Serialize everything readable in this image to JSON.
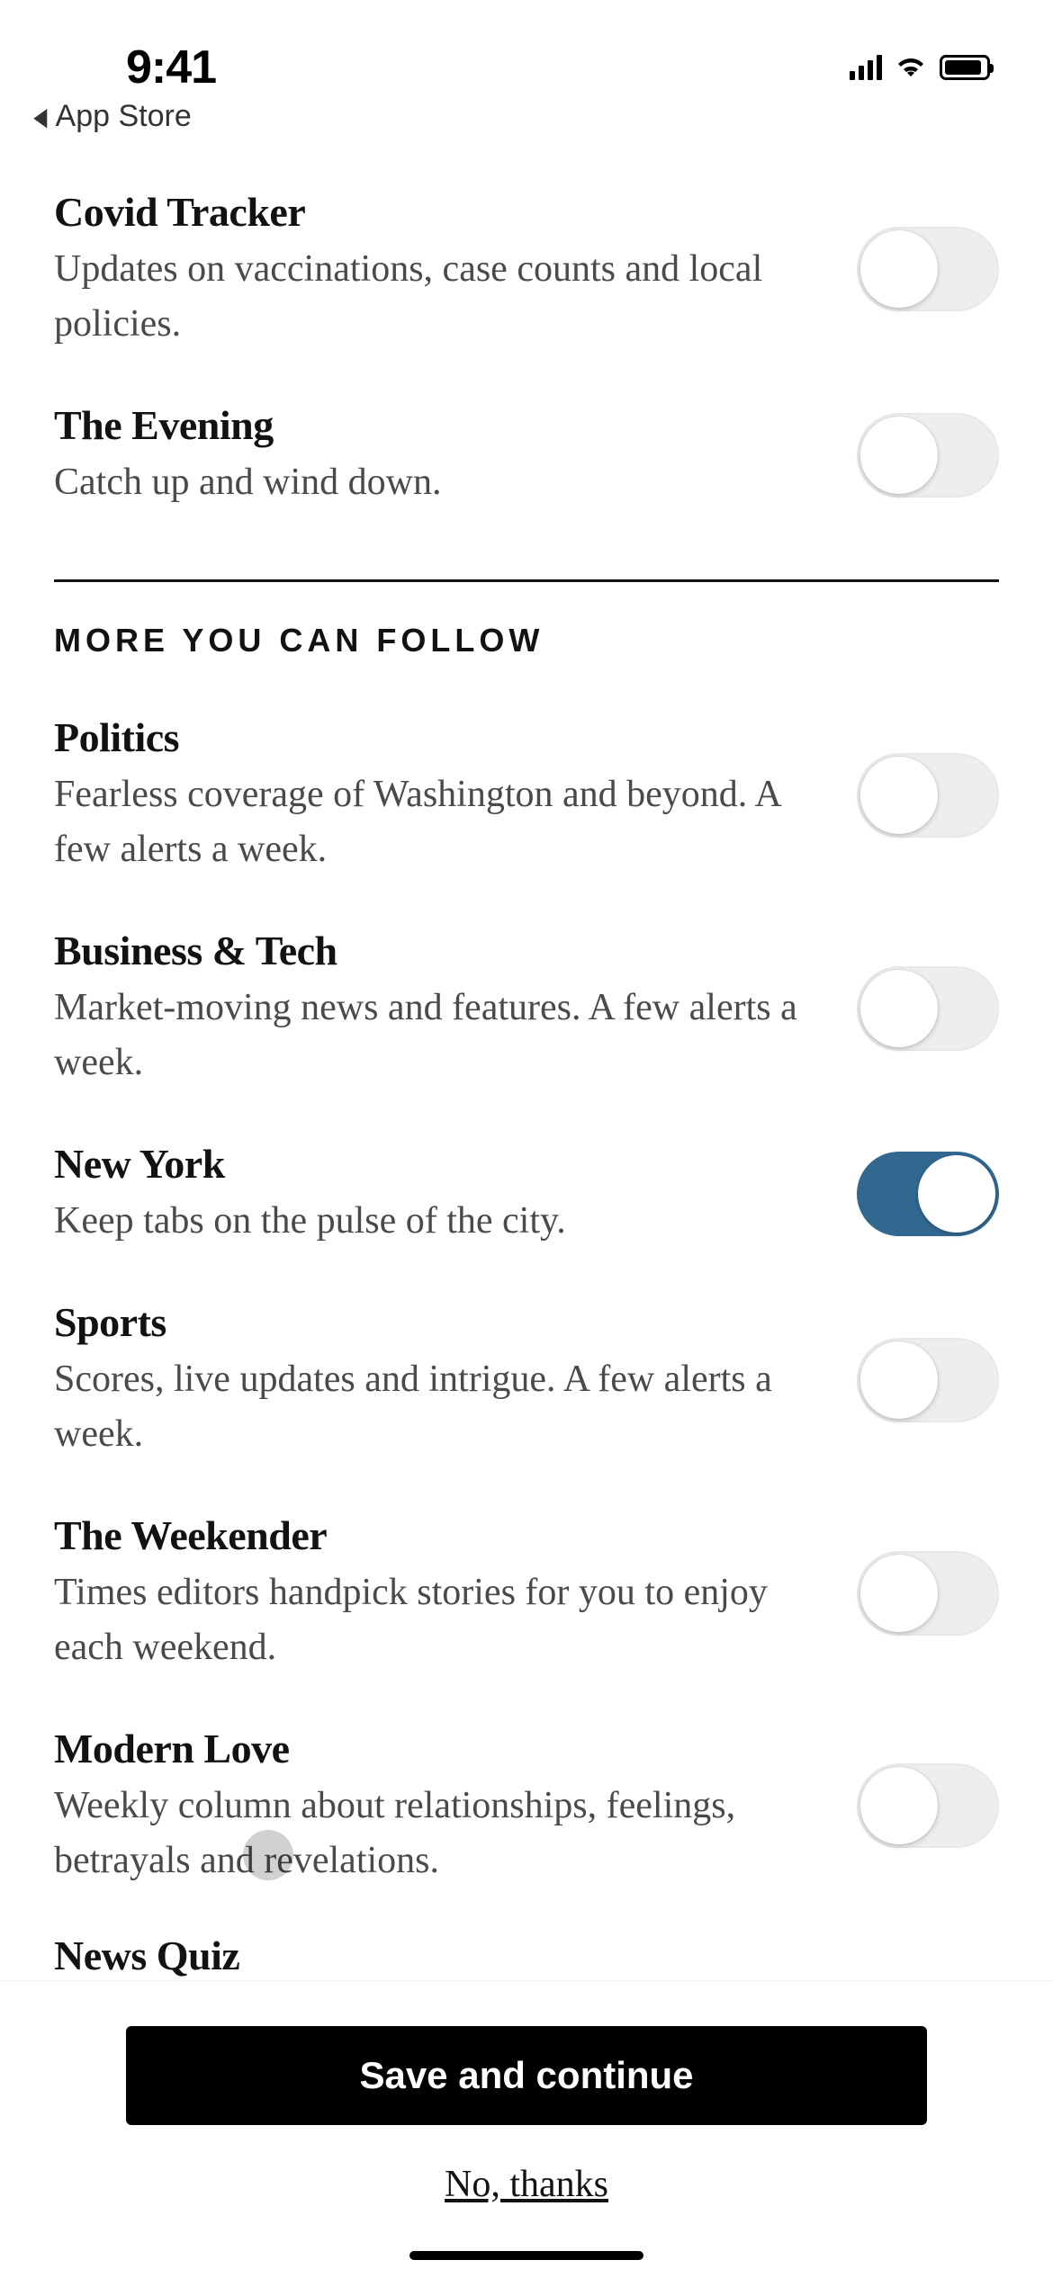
{
  "status": {
    "time": "9:41",
    "back_label": "App Store"
  },
  "top_items": [
    {
      "title": "Covid Tracker",
      "desc": "Updates on vaccinations, case counts and local policies.",
      "on": false
    },
    {
      "title": "The Evening",
      "desc": "Catch up and wind down.",
      "on": false
    }
  ],
  "section_header": "MORE YOU CAN FOLLOW",
  "follow_items": [
    {
      "title": "Politics",
      "desc": "Fearless coverage of Washington and beyond. A few alerts a week.",
      "on": false
    },
    {
      "title": "Business & Tech",
      "desc": "Market-moving news and features. A few alerts a week.",
      "on": false
    },
    {
      "title": "New York",
      "desc": "Keep tabs on the pulse of the city.",
      "on": true
    },
    {
      "title": "Sports",
      "desc": "Scores, live updates and intrigue. A few alerts a week.",
      "on": false
    },
    {
      "title": "The Weekender",
      "desc": "Times editors handpick stories for you to enjoy each weekend.",
      "on": false
    },
    {
      "title": "Modern Love",
      "desc": "Weekly column about relationships, feelings, betrayals and revelations.",
      "on": false
    }
  ],
  "partial_item": {
    "title": "News Quiz"
  },
  "footer": {
    "save_label": "Save and continue",
    "no_thanks_label": "No, thanks"
  },
  "colors": {
    "accent_on": "#326890"
  }
}
